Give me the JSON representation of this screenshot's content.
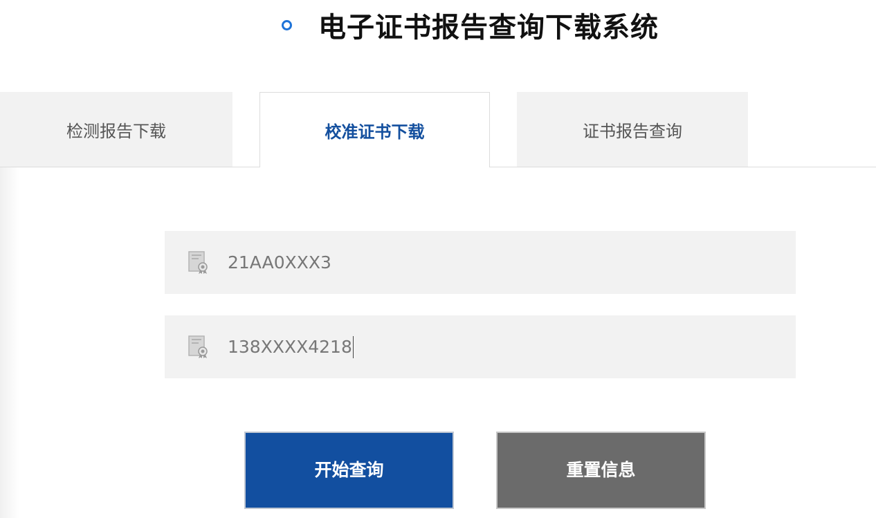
{
  "header": {
    "title": "电子证书报告查询下载系统",
    "title_bullet_icon": "circle-bullet-icon",
    "accent_color": "#1e73d8"
  },
  "tabs": [
    {
      "label": "检测报告下载",
      "active": false
    },
    {
      "label": "校准证书下载",
      "active": true
    },
    {
      "label": "证书报告查询",
      "active": false
    }
  ],
  "form": {
    "certificate_number": {
      "value": "21AA0XXX3",
      "icon": "certificate-icon"
    },
    "phone": {
      "value": "138XXXX4218",
      "icon": "certificate-icon"
    }
  },
  "actions": {
    "query_label": "开始查询",
    "reset_label": "重置信息",
    "query_color": "#124fa0",
    "reset_color": "#6b6b6b"
  },
  "colors": {
    "active_tab_text": "#134f9e",
    "inactive_tab_bg": "#f2f2f2",
    "field_bg": "#f2f2f2"
  }
}
